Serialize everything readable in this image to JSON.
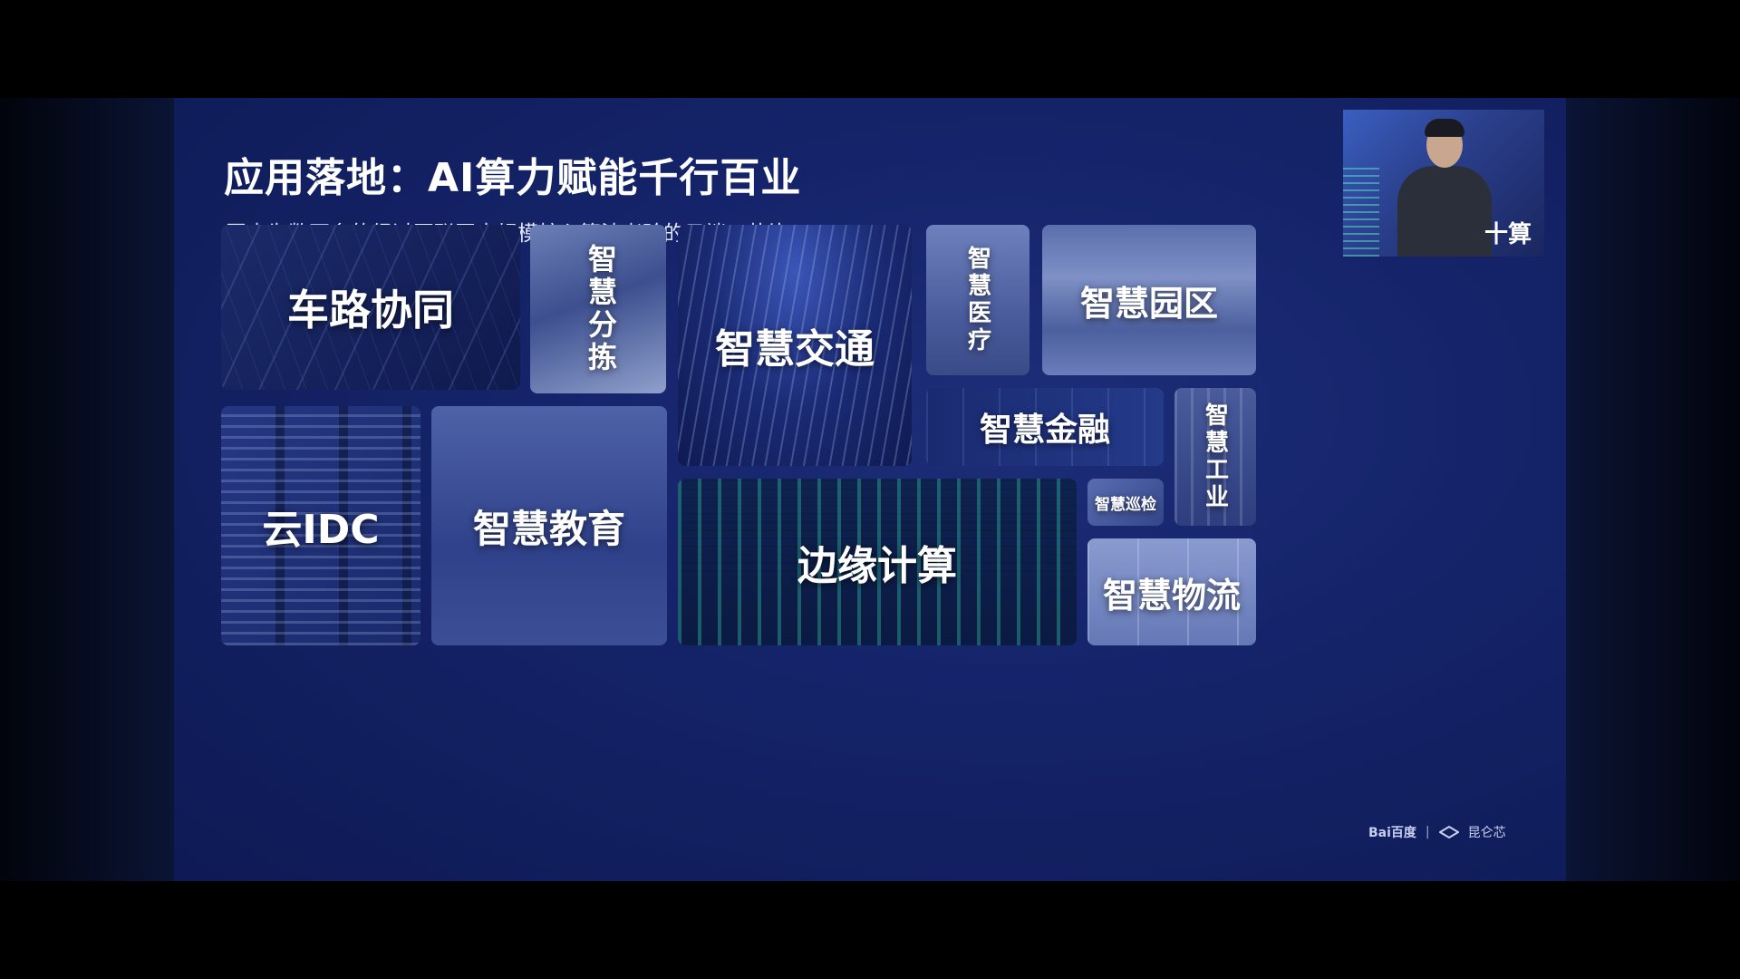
{
  "slide": {
    "title": "应用落地：AI算力赋能千行百业",
    "subtitle": "国内为数不多的经过互联网大规模核心算法考验的云端AI芯片"
  },
  "tiles": {
    "vehicle_road": "车路协同",
    "sorting": "智慧分拣",
    "traffic": "智慧交通",
    "medical": "智慧医疗",
    "park": "智慧园区",
    "finance": "智慧金融",
    "industry": "智慧工业",
    "cloud_idc": "云IDC",
    "education": "智慧教育",
    "edge": "边缘计算",
    "patrol": "智慧巡检",
    "logistics": "智慧物流"
  },
  "speaker_video": {
    "caption": "十算"
  },
  "footer": {
    "logo_baidu": "Bai百度",
    "separator": "|",
    "logo_kunlun": "昆仑芯"
  }
}
